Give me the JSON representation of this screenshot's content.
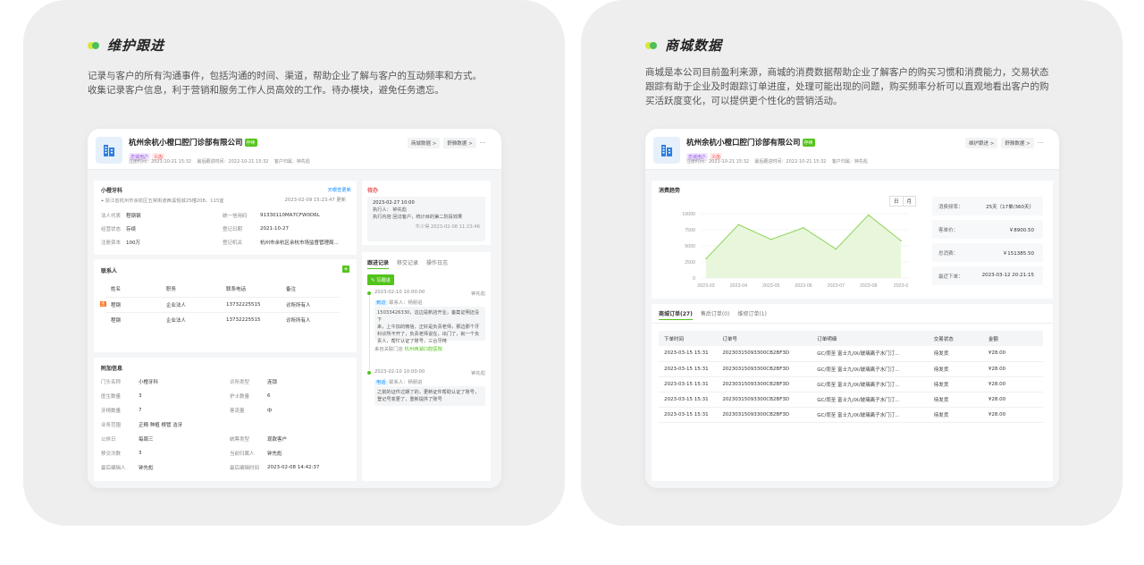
{
  "panel_maintain": {
    "title": "维护跟进",
    "desc_line1": "记录与客户的所有沟通事件，包括沟通的时间、渠道，帮助企业了解与客户的互动频率和方式。",
    "desc_line2": "收集记录客户信息，利于营销和服务工作人员高效的工作。待办模块，避免任务遗忘。"
  },
  "panel_mall": {
    "title": "商城数据",
    "desc_line1": "商城是本公司目前盈利来源，商城的消费数据帮助企业了解客户的购买习惯和消费能力，交易状态",
    "desc_line2": "跟踪有助于企业及时跟踪订单进度，处理可能出现的问题，购买频率分析可以直观地看出客户的购",
    "desc_line3": "买活跃度变化，可以提供更个性化的营销活动。"
  },
  "company": {
    "name": "杭州余杭小橙口腔门诊部有限公司",
    "status_tag": "存续",
    "label_a": "忠诚用户",
    "label_b": "义齿",
    "meta_register": "注册时间：2021-10-21 15:32",
    "meta_last": "最后跟进时间：2022-10-21 15:32",
    "meta_owner": "客户归属：钟先彪",
    "btn_follow": "维护跟进 >",
    "btn_mall": "商城数据 >",
    "btn_finance": "舒雅数据 >",
    "more": "···"
  },
  "info": {
    "title": "小橙牙科",
    "update_link": "天眼查更新",
    "address": "浙江省杭州市余杭区五常街道西溪悦城25幢208、115室",
    "update_time": "2023-02-09 15:23:47 更新",
    "rows": [
      {
        "k1": "法人代表",
        "v1": "程钢钢",
        "k2": "统一信用码",
        "v2": "91330110MA7CFW0D6L"
      },
      {
        "k1": "经营状态",
        "v1": "存续",
        "k2": "登记日期",
        "v2": "2021-10-27"
      },
      {
        "k1": "注册资本",
        "v1": "100万",
        "k2": "登记机关",
        "v2": "杭州市余杭区余杭市场监督管理局..."
      }
    ]
  },
  "contacts": {
    "title": "联系人",
    "add": "+",
    "headers": [
      "姓名",
      "职务",
      "联系电话",
      "备注"
    ],
    "rows": [
      {
        "name": "程钢",
        "role": "企业法人",
        "phone": "13732225515",
        "note": "诊所所有人",
        "badge": "主"
      },
      {
        "name": "程钢",
        "role": "企业法人",
        "phone": "13732225515",
        "note": "诊所所有人",
        "badge": ""
      }
    ]
  },
  "extra": {
    "title": "附加信息",
    "rows": [
      {
        "k1": "门头名称",
        "v1": "小橙牙科",
        "k2": "诊所类型",
        "v2": "连锁"
      },
      {
        "k1": "医生数量",
        "v1": "3",
        "k2": "护士数量",
        "v2": "6"
      },
      {
        "k1": "牙椅数量",
        "v1": "7",
        "k2": "客流量",
        "v2": "中"
      },
      {
        "k1": "业务范围",
        "v1": "正畸 种植 根管 洁牙",
        "k2": "",
        "v2": ""
      },
      {
        "k1": "公休日",
        "v1": "每周三",
        "k2": "统筹类型",
        "v2": "现款客户"
      },
      {
        "k1": "移交次数",
        "v1": "3",
        "k2": "当前归属人",
        "v2": "钟先彪"
      },
      {
        "k1": "最后编辑人",
        "v1": "钟先彪",
        "k2": "最后编辑时间",
        "v2": "2023-02-08 14:42:37"
      }
    ]
  },
  "todo": {
    "title": "待办",
    "time": "2023-02-27 10:00",
    "executor": "执行人：   钟先彪",
    "content": "执行内容   回访客户，统计目的第二阶段效果",
    "footer": "牛少得  2023-02-08 11:23:46"
  },
  "follow": {
    "tabs": [
      "跟进记录",
      "移交记录",
      "操作日志"
    ],
    "write_btn": "写跟进",
    "items": [
      {
        "time": "2023-02-10 10:00:00",
        "owner": "钟先彪",
        "tag": "到访",
        "contact": "联系人：杨朋进",
        "text1": "15033426330，这边是新店开业，备案证明还没下",
        "text2": "来，上午加的微信，正好是负责老师，那边那个牙",
        "text3": "科诊所不开了，负责老师说在，出门了，就一个负",
        "text4": "责人，帮忙认证了账号，三台牙椅",
        "from_label": "来自关联门店",
        "from_link": "杭州西湖口腔医院"
      },
      {
        "time": "2023-02-10 10:00:00",
        "owner": "钟先彪",
        "tag": "电话",
        "contact": "联系人：杨朋进",
        "text1": "之前的证件过期了的，更新证件帮助认证了账号，",
        "text2": "登记号变更了，重新提供了账号"
      }
    ]
  },
  "consume": {
    "title": "消费趋势",
    "toggle_day": "日",
    "toggle_month": "月",
    "stats": [
      {
        "k": "消费频率：",
        "v": "25天（17单/360天）"
      },
      {
        "k": "客单价：",
        "v": "￥8900.50"
      },
      {
        "k": "总消费：",
        "v": "￥151385.50"
      },
      {
        "k": "最近下单：",
        "v": "2023-03-12 20:21:15"
      }
    ]
  },
  "chart_data": {
    "type": "area",
    "categories": [
      "2023-03",
      "2023-04",
      "2023-05",
      "2023-06",
      "2023-07",
      "2023-08",
      "2023-09"
    ],
    "values": [
      3000,
      8300,
      6000,
      7800,
      4500,
      9800,
      5800
    ],
    "ytick_labels": [
      "0",
      "2500",
      "5000",
      "7500",
      "10000"
    ],
    "last_x_label": "2023-0",
    "ylim": [
      0,
      10000
    ],
    "line_color": "#8fd35a",
    "fill_color": "#e6f6d8",
    "grid": true
  },
  "orders": {
    "tabs": [
      "商城订单(27)",
      "售后订单(0)",
      "维修订单(1)"
    ],
    "headers": [
      "下单时间",
      "订单号",
      "订单明细",
      "交易状态",
      "金额"
    ],
    "rows": [
      [
        "2023-03-15 15:31",
        "20230315093300CB2BF3D",
        "GC/而至 富士九/IX/玻璃离子水门汀...",
        "待发货",
        "¥28.00"
      ],
      [
        "2023-03-15 15:31",
        "20230315093300CB2BF3D",
        "GC/而至 富士九/IX/玻璃离子水门汀...",
        "待发货",
        "¥28.00"
      ],
      [
        "2023-03-15 15:31",
        "20230315093300CB2BF3D",
        "GC/而至 富士九/IX/玻璃离子水门汀...",
        "待发货",
        "¥28.00"
      ],
      [
        "2023-03-15 15:31",
        "20230315093300CB2BF3D",
        "GC/而至 富士九/IX/玻璃离子水门汀...",
        "待发货",
        "¥28.00"
      ],
      [
        "2023-03-15 15:31",
        "20230315093300CB2BF3D",
        "GC/而至 富士九/IX/玻璃离子水门汀...",
        "待发货",
        "¥28.00"
      ]
    ]
  }
}
